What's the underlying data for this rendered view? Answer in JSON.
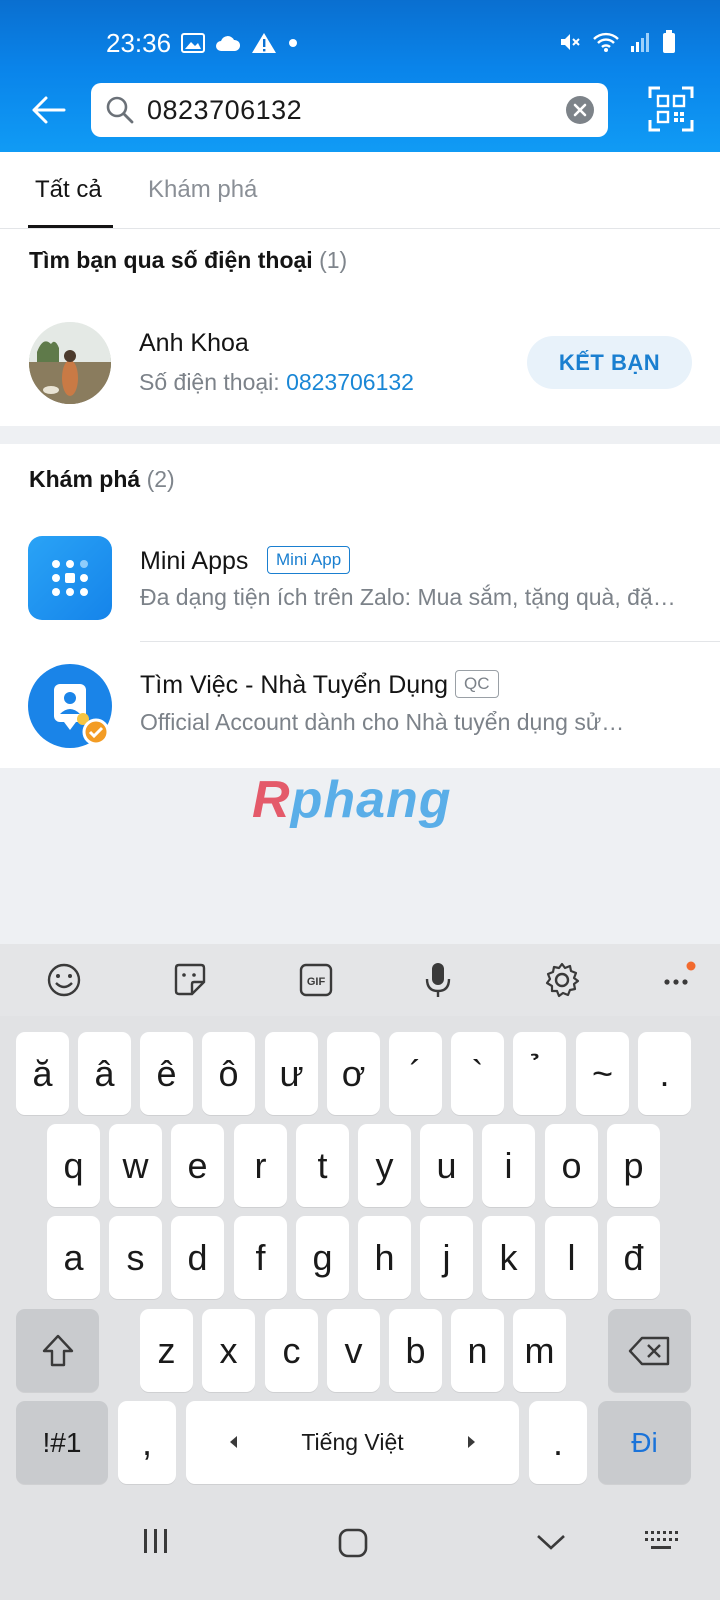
{
  "status": {
    "time": "23:36"
  },
  "header": {
    "search_value": "0823706132",
    "back_icon": "arrow-left-icon",
    "qr_icon": "qr-code-icon"
  },
  "tabs": [
    {
      "label": "Tất cả"
    },
    {
      "label": "Khám phá"
    }
  ],
  "phone_section": {
    "title": "Tìm bạn qua số điện thoại",
    "count": "(1)",
    "result": {
      "name": "Anh Khoa",
      "phone_label": "Số điện thoại:",
      "phone": "0823706132",
      "button": "KẾT BẠN"
    }
  },
  "explore_section": {
    "title": "Khám phá",
    "count": "(2)",
    "items": [
      {
        "name": "Mini Apps",
        "badge": "Mini App",
        "desc": "Đa dạng tiện ích trên Zalo: Mua sắm, tặng quà, đặt…"
      },
      {
        "name": "Tìm Việc - Nhà Tuyển Dụng",
        "badge": "QC",
        "desc": "Official Account dành cho Nhà tuyển dụng sử…"
      }
    ]
  },
  "watermark": {
    "first": "R",
    "rest": "phang"
  },
  "keyboard": {
    "row0": [
      "ă",
      "â",
      "ê",
      "ô",
      "ư",
      "ơ",
      "´",
      "`",
      "̉",
      "~",
      "."
    ],
    "row1": [
      "q",
      "w",
      "e",
      "r",
      "t",
      "y",
      "u",
      "i",
      "o",
      "p"
    ],
    "row2": [
      "a",
      "s",
      "d",
      "f",
      "g",
      "h",
      "j",
      "k",
      "l",
      "đ"
    ],
    "row3": [
      "z",
      "x",
      "c",
      "v",
      "b",
      "n",
      "m"
    ],
    "symbols": "!#1",
    "comma": ",",
    "space_label": "Tiếng Việt",
    "period": ".",
    "go": "Đi"
  },
  "colors": {
    "accent": "#0a84ea",
    "link": "#1a87d6"
  }
}
